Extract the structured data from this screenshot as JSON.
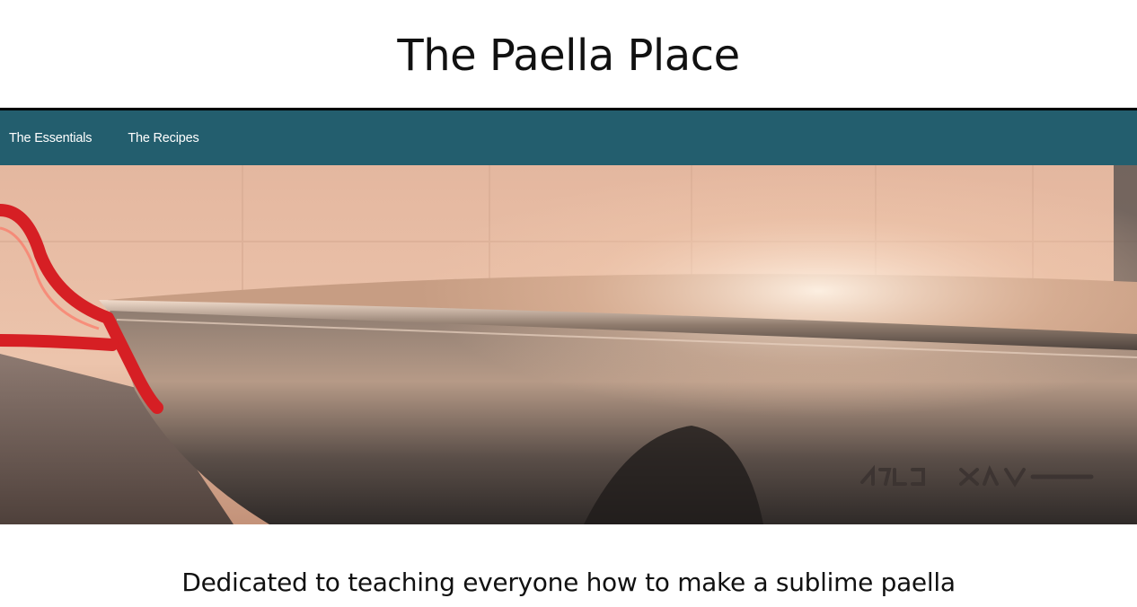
{
  "header": {
    "title": "The Paella Place"
  },
  "nav": {
    "items": [
      {
        "label": "The Essentials"
      },
      {
        "label": "The Recipes"
      }
    ],
    "background_color": "#235e6e",
    "border_color": "#000000"
  },
  "hero": {
    "description": "Photo of a steel paella pan with red handles",
    "stamp_text": "GRANDE"
  },
  "main": {
    "tagline": "Dedicated to teaching everyone how to make a sublime paella"
  }
}
